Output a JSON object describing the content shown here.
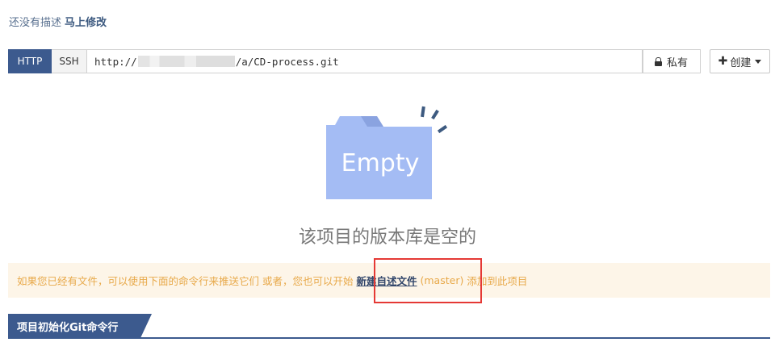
{
  "description": {
    "text": "还没有描述",
    "edit_link": "马上修改"
  },
  "repo": {
    "protocols": [
      "HTTP",
      "SSH"
    ],
    "url_prefix": "http://",
    "url_suffix": "/a/CD-process.git",
    "visibility": "私有",
    "create_label": "创建"
  },
  "empty": {
    "illustration_text": "Empty",
    "title": "该项目的版本库是空的"
  },
  "notice": {
    "before": "如果您已经有文件，可以使用下面的命令行来推送它们 或者，您也可以开始",
    "link": "新建自述文件",
    "branch": "(master)",
    "after": "添加到此项目"
  },
  "section": {
    "title": "项目初始化Git命令行"
  },
  "colors": {
    "primary": "#3c5a8e",
    "illustration": "#a4bcf4",
    "notice_bg": "#fdf5e8",
    "notice_text": "#e8a94a",
    "highlight": "#e53935"
  },
  "icons": {
    "lock": "lock-icon",
    "plus": "plus-icon",
    "caret": "caret-down-icon"
  }
}
